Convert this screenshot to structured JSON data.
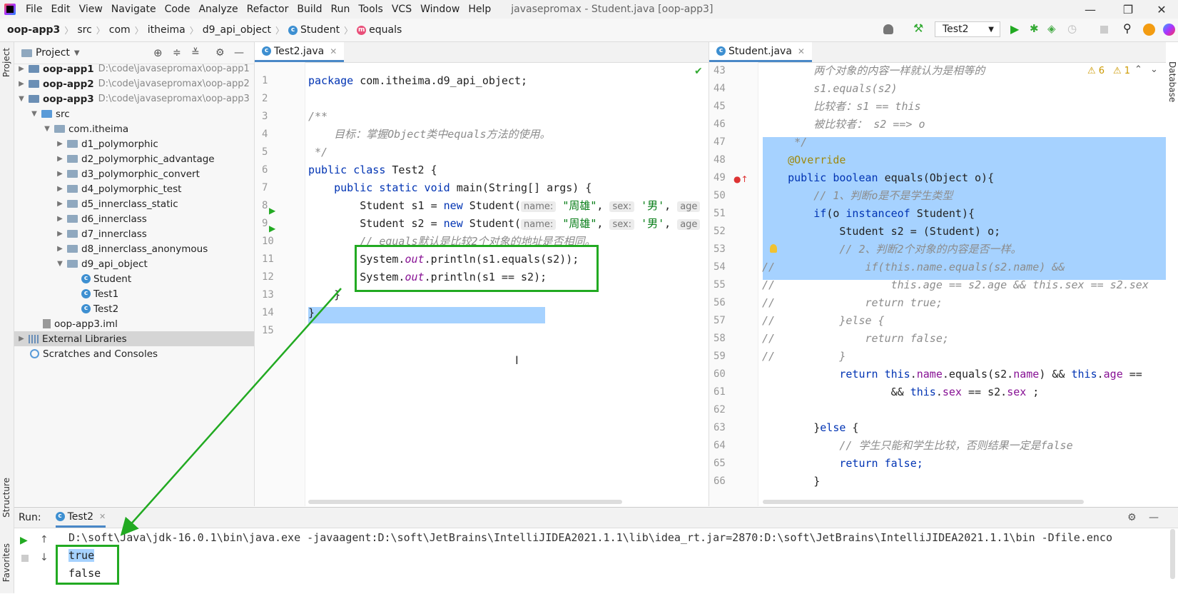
{
  "menubar": {
    "items": [
      "File",
      "Edit",
      "View",
      "Navigate",
      "Code",
      "Analyze",
      "Refactor",
      "Build",
      "Run",
      "Tools",
      "VCS",
      "Window",
      "Help"
    ],
    "title": "javasepromax - Student.java [oop-app3]"
  },
  "breadcrumb": [
    "oop-app3",
    "src",
    "com",
    "itheima",
    "d9_api_object",
    "Student",
    "equals"
  ],
  "run_config": "Test2",
  "side_labels": {
    "project": "Project",
    "structure": "Structure",
    "favorites": "Favorites",
    "database": "Database"
  },
  "project": {
    "title": "Project",
    "tree": [
      {
        "label": "oop-app1",
        "path": "D:\\code\\javasepromax\\oop-app1"
      },
      {
        "label": "oop-app2",
        "path": "D:\\code\\javasepromax\\oop-app2"
      },
      {
        "label": "oop-app3",
        "path": "D:\\code\\javasepromax\\oop-app3"
      },
      {
        "label": "src"
      },
      {
        "label": "com.itheima"
      },
      {
        "label": "d1_polymorphic"
      },
      {
        "label": "d2_polymorphic_advantage"
      },
      {
        "label": "d3_polymorphic_convert"
      },
      {
        "label": "d4_polymorphic_test"
      },
      {
        "label": "d5_innerclass_static"
      },
      {
        "label": "d6_innerclass"
      },
      {
        "label": "d7_innerclass"
      },
      {
        "label": "d8_innerclass_anonymous"
      },
      {
        "label": "d9_api_object"
      },
      {
        "label": "Student"
      },
      {
        "label": "Test1"
      },
      {
        "label": "Test2"
      },
      {
        "label": "oop-app3.iml"
      },
      {
        "label": "External Libraries"
      },
      {
        "label": "Scratches and Consoles"
      }
    ]
  },
  "editor_left": {
    "tab": "Test2.java",
    "lines": {
      "l1a": "package",
      "l1b": " com.itheima.d9_api_object;",
      "l3": "/**",
      "l4": "    目标：掌握Object类中equals方法的使用。",
      "l5": " */",
      "l6a": "public class",
      "l6b": " Test2 {",
      "l7a": "    public static void",
      "l7b": " main(String[] args) {",
      "l8a": "        Student ",
      "l8b": "s1",
      "l8c": " = ",
      "l8d": "new",
      "l8e": " Student(",
      "l9a": "        Student ",
      "l9b": "s2",
      "l9c": " = ",
      "l9d": "new",
      "l9e": " Student(",
      "hint_name": "name:",
      "hint_sex": "sex:",
      "hint_age": "age",
      "str_name": "\"周雄\"",
      "str_sex": "'男'",
      "comma": ", ",
      "l10": "        // equals默认是比较2个对象的地址是否相同。",
      "l11a": "        System.",
      "l11b": "out",
      "l11c": ".println(s1.equals(s2));",
      "l12a": "        System.",
      "l12b": "out",
      "l12c": ".println(s1 == s2);",
      "l13": "    }",
      "l14": "}"
    },
    "line_numbers": [
      "1",
      "2",
      "3",
      "4",
      "5",
      "6",
      "7",
      "8",
      "9",
      "10",
      "11",
      "12",
      "13",
      "14",
      "15"
    ]
  },
  "editor_right": {
    "tab": "Student.java",
    "warnings": "6",
    "weak_warnings": "1",
    "line_numbers": [
      "43",
      "44",
      "45",
      "46",
      "47",
      "48",
      "49",
      "50",
      "51",
      "52",
      "53",
      "54",
      "55",
      "56",
      "57",
      "58",
      "59",
      "60",
      "61",
      "62",
      "63",
      "64",
      "65",
      "66"
    ],
    "lines": {
      "l43": "        两个对象的内容一样就认为是相等的",
      "l44": "        s1.equals(s2)",
      "l45": "        比较者：s1 == this",
      "l46": "        被比较者： s2 ==> o",
      "l47": "     */",
      "l48": "    @Override",
      "l49a": "    public boolean",
      "l49b": " equals(Object o){",
      "l50": "        // 1、判断o是不是学生类型",
      "l51a": "        if",
      "l51b": "(o ",
      "l51c": "instanceof",
      "l51d": " Student){",
      "l52": "            Student s2 = (Student) o;",
      "l53": "            // 2、判断2个对象的内容是否一样。",
      "l54": "//              if(this.name.equals(s2.name) &&",
      "l55": "//                  this.age == s2.age && this.sex == s2.sex",
      "l56": "//              return true;",
      "l57": "//          }else {",
      "l58": "//              return false;",
      "l59": "//          }",
      "l60a": "            return",
      "l60b": " this",
      "l60c": ".",
      "l60d": "name",
      "l60e": ".equals(s2.",
      "l60f": "name",
      "l60g": ") && ",
      "l60h": "this",
      "l60i": ".",
      "l60j": "age",
      "l60k": " ==",
      "l61a": "                    && ",
      "l61b": "this",
      "l61c": ".",
      "l61d": "sex",
      "l61e": " == s2.",
      "l61f": "sex",
      "l61g": " ;",
      "l63a": "        }",
      "l63b": "else",
      "l63c": " {",
      "l64": "            // 学生只能和学生比较，否则结果一定是false",
      "l65a": "            return",
      "l65b": " false;",
      "l66": "        }"
    }
  },
  "run_panel": {
    "label": "Run:",
    "tab": "Test2",
    "cmd": "D:\\soft\\Java\\jdk-16.0.1\\bin\\java.exe -javaagent:D:\\soft\\JetBrains\\IntelliJIDEA2021.1.1\\lib\\idea_rt.jar=2870:D:\\soft\\JetBrains\\IntelliJIDEA2021.1.1\\bin -Dfile.enco",
    "output": [
      "true",
      "false"
    ]
  },
  "colors": {
    "highlight": "#a6d2ff",
    "annotation_box": "#22aa22",
    "keyword": "#0033b3"
  }
}
